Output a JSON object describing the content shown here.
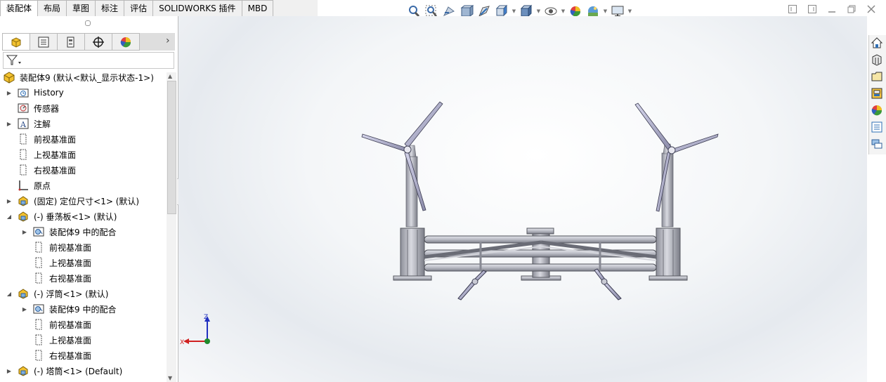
{
  "tabs": [
    {
      "label": "装配体",
      "active": true
    },
    {
      "label": "布局"
    },
    {
      "label": "草图"
    },
    {
      "label": "标注"
    },
    {
      "label": "评估"
    },
    {
      "label": "SOLIDWORKS 插件"
    },
    {
      "label": "MBD"
    }
  ],
  "heads_up_toolbar": [
    "zoom-to-fit-icon",
    "zoom-to-area-icon",
    "previous-view-icon",
    "section-view-icon",
    "dynamic-annotation-icon",
    "view-orientation-icon",
    "display-style-icon",
    "hide-show-items-icon",
    "edit-appearance-icon",
    "apply-scene-icon",
    "view-settings-icon"
  ],
  "feature_tree": {
    "root": "装配体9  (默认<默认_显示状态-1>)",
    "items": [
      {
        "label": "History"
      },
      {
        "label": "传感器"
      },
      {
        "label": "注解"
      },
      {
        "label": "前视基准面"
      },
      {
        "label": "上视基准面"
      },
      {
        "label": "右视基准面"
      },
      {
        "label": "原点"
      },
      {
        "label": "(固定) 定位尺寸<1> (默认)"
      },
      {
        "label": "(-) 垂荡板<1> (默认)"
      },
      {
        "label": "装配体9 中的配合"
      },
      {
        "label": "前视基准面"
      },
      {
        "label": "上视基准面"
      },
      {
        "label": "右视基准面"
      },
      {
        "label": "(-) 浮筒<1> (默认)"
      },
      {
        "label": "装配体9 中的配合"
      },
      {
        "label": "前视基准面"
      },
      {
        "label": "上视基准面"
      },
      {
        "label": "右视基准面"
      },
      {
        "label": "(-) 塔筒<1> (Default)"
      }
    ]
  },
  "triad": {
    "x": "X",
    "z": "Z"
  },
  "colors": {
    "accent": "#2f6fb5",
    "part_yellow": "#e8c23a",
    "x_axis": "#d02020",
    "z_axis": "#2030c0",
    "y_axis": "#1f8a2c"
  }
}
